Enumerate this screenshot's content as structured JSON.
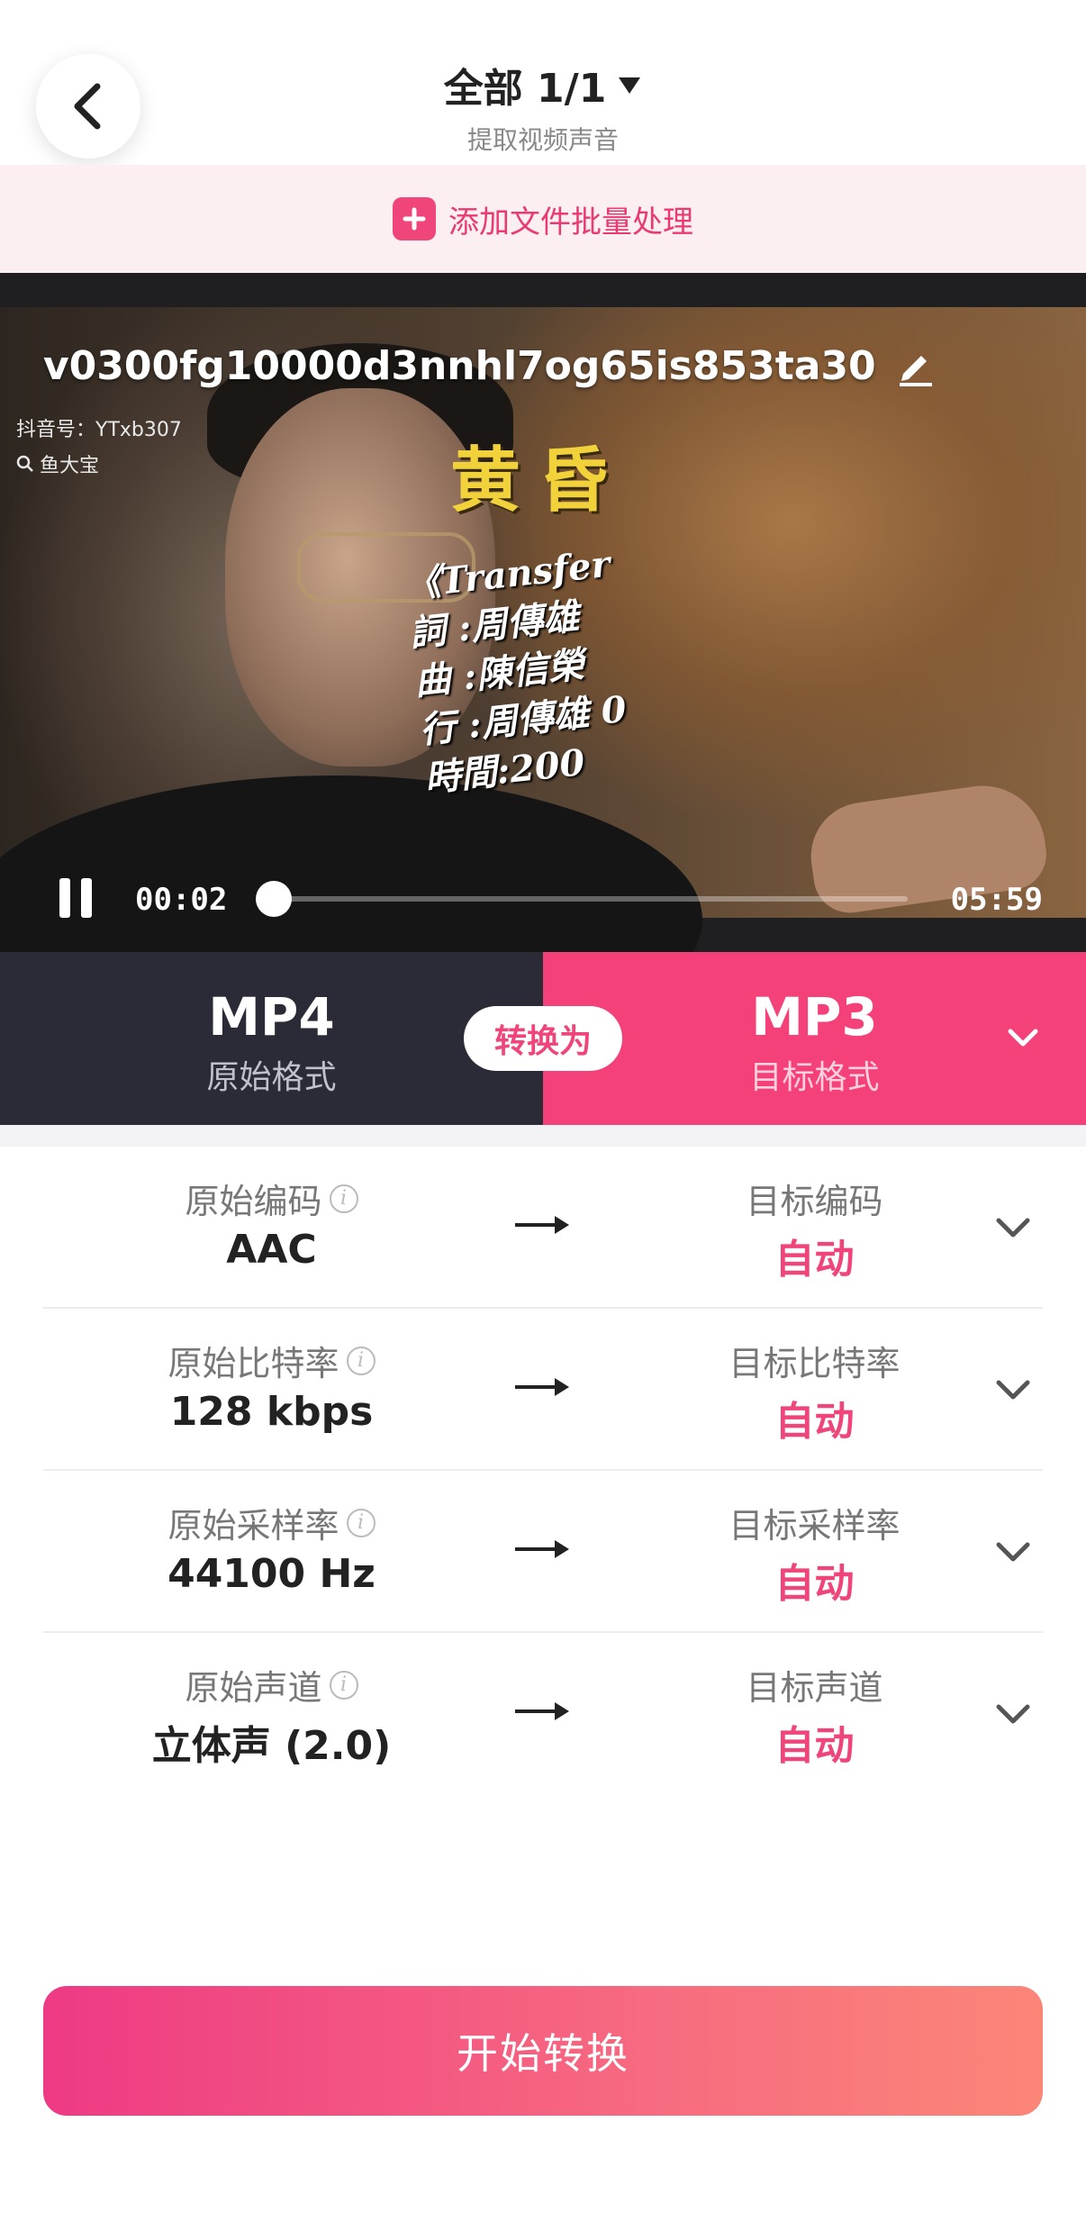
{
  "header": {
    "title": "全部 1/1",
    "subtitle": "提取视频声音",
    "back_icon": "chevron-left-icon",
    "dropdown_icon": "triangle-down-icon"
  },
  "add_bar": {
    "label": "添加文件批量处理",
    "icon": "plus-icon",
    "accent": "#f0457a"
  },
  "video": {
    "filename": "v0300fg10000d3nnhl7og65is853ta30",
    "watermark_app": "抖音号：YTxb307",
    "watermark_user": "鱼大宝",
    "overlay_title": "黄昏",
    "overlay_lines": [
      "《Transfer",
      "詞 :周傳雄",
      "曲 :陳信榮",
      "行 :周傳雄 0",
      "時間:200"
    ],
    "current_time": "00:02",
    "total_time": "05:59",
    "progress": 0.006
  },
  "format": {
    "source_name": "MP4",
    "source_label": "原始格式",
    "convert_label": "转换为",
    "target_name": "MP3",
    "target_label": "目标格式",
    "target_color": "#f5417a",
    "source_color": "#2a2b36"
  },
  "params": [
    {
      "src_label": "原始编码",
      "src_value": "AAC",
      "dst_label": "目标编码",
      "dst_value": "自动"
    },
    {
      "src_label": "原始比特率",
      "src_value": "128 kbps",
      "dst_label": "目标比特率",
      "dst_value": "自动"
    },
    {
      "src_label": "原始采样率",
      "src_value": "44100 Hz",
      "dst_label": "目标采样率",
      "dst_value": "自动"
    },
    {
      "src_label": "原始声道",
      "src_value": "立体声 (2.0)",
      "dst_label": "目标声道",
      "dst_value": "自动"
    }
  ],
  "start_button": {
    "label": "开始转换"
  }
}
